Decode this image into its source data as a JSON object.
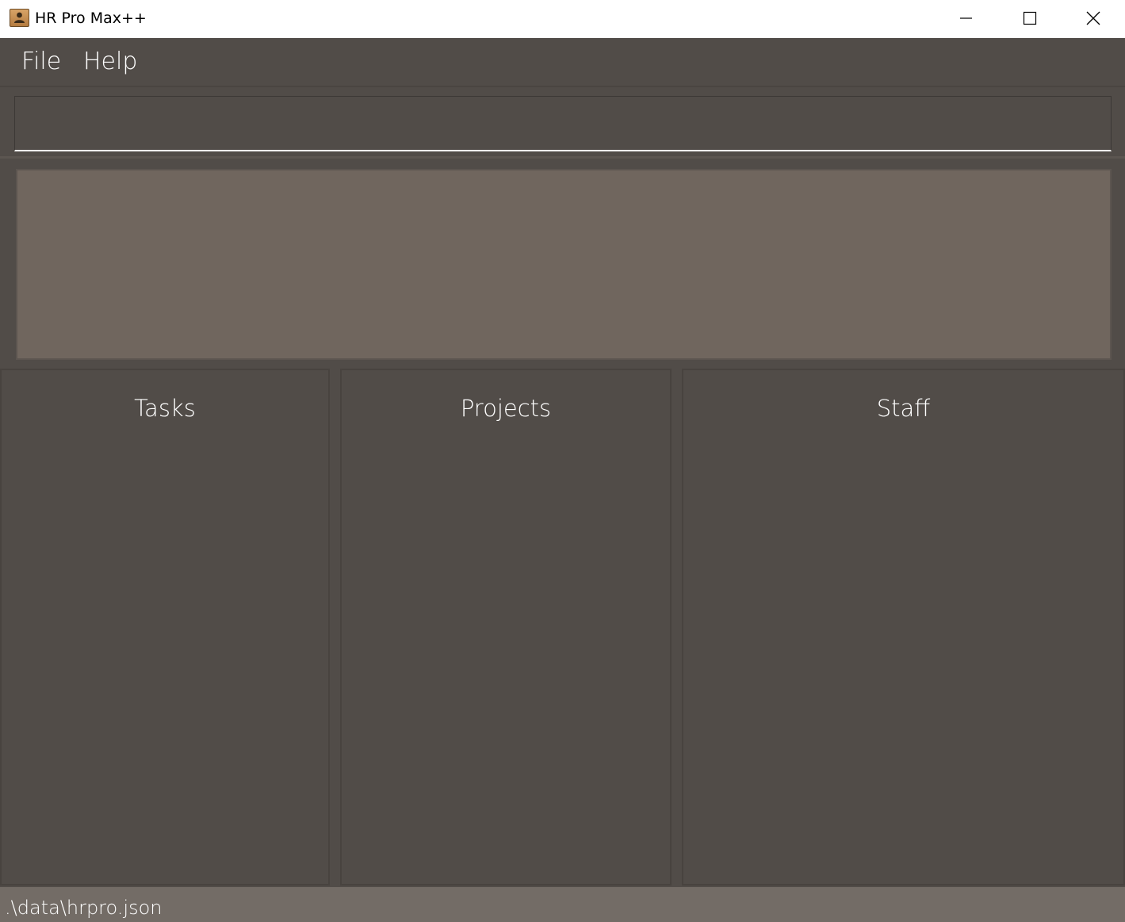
{
  "window": {
    "title": "HR Pro Max++",
    "app_icon": "contact-book-icon",
    "controls": {
      "minimize_icon": "minimize-icon",
      "maximize_icon": "maximize-icon",
      "close_icon": "close-icon"
    }
  },
  "menu": {
    "file_label": "File",
    "help_label": "Help"
  },
  "command_box": {
    "value": "",
    "placeholder": ""
  },
  "result_display": {
    "text": ""
  },
  "lists": {
    "tasks": {
      "title": "Tasks",
      "items": []
    },
    "projects": {
      "title": "Projects",
      "items": []
    },
    "staff": {
      "title": "Staff",
      "items": []
    }
  },
  "status_bar": {
    "file_path": ".\\data\\hrpro.json"
  },
  "colors": {
    "background": "#514c48",
    "result_background": "#70665e",
    "status_background": "#736c66",
    "text": "#ffffff"
  }
}
